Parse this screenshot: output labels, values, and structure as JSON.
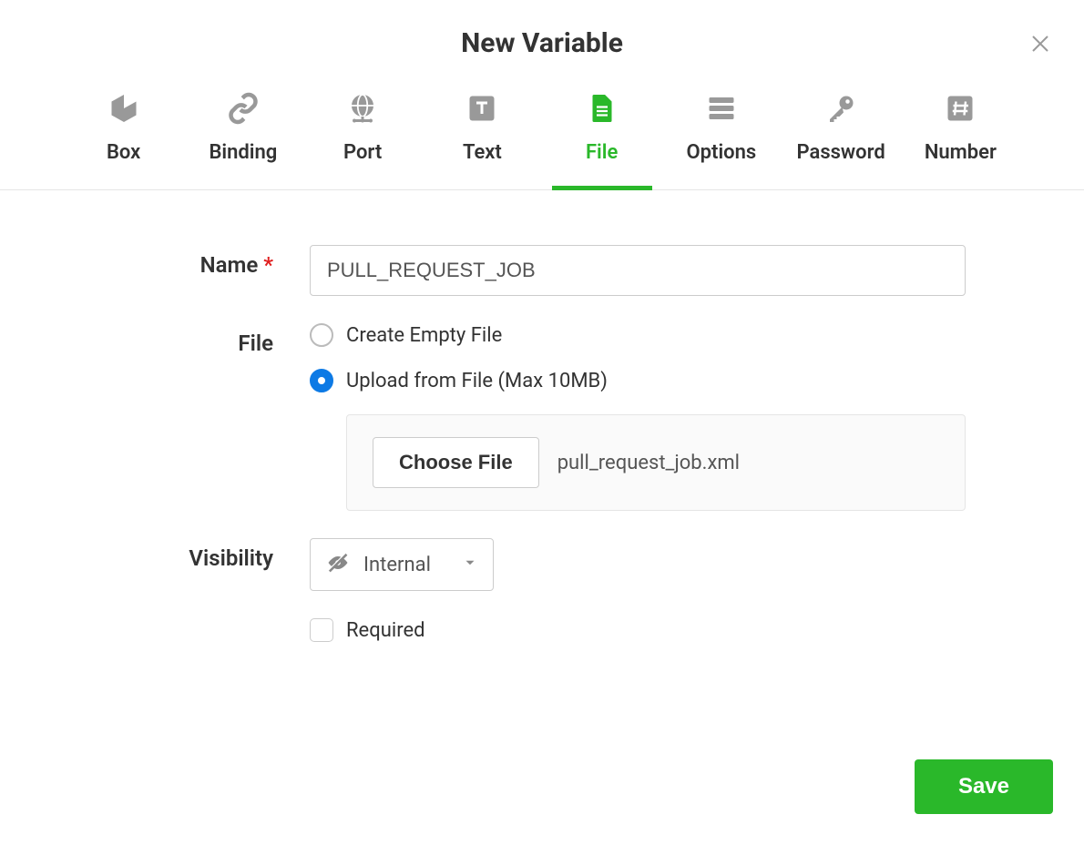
{
  "dialog": {
    "title": "New Variable"
  },
  "tabs": [
    {
      "label": "Box",
      "icon": "box-icon",
      "active": false
    },
    {
      "label": "Binding",
      "icon": "link-icon",
      "active": false
    },
    {
      "label": "Port",
      "icon": "globe-icon",
      "active": false
    },
    {
      "label": "Text",
      "icon": "text-icon",
      "active": false
    },
    {
      "label": "File",
      "icon": "file-icon",
      "active": true
    },
    {
      "label": "Options",
      "icon": "list-icon",
      "active": false
    },
    {
      "label": "Password",
      "icon": "key-icon",
      "active": false
    },
    {
      "label": "Number",
      "icon": "hash-icon",
      "active": false
    }
  ],
  "form": {
    "name_label": "Name",
    "name_value": "PULL_REQUEST_JOB",
    "file_label": "File",
    "file_options": {
      "create_empty": {
        "label": "Create Empty File",
        "selected": false
      },
      "upload": {
        "label": "Upload from File (Max 10MB)",
        "selected": true
      }
    },
    "choose_file_label": "Choose File",
    "uploaded_filename": "pull_request_job.xml",
    "visibility_label": "Visibility",
    "visibility_value": "Internal",
    "required_label": "Required",
    "required_checked": false
  },
  "actions": {
    "save_label": "Save"
  }
}
